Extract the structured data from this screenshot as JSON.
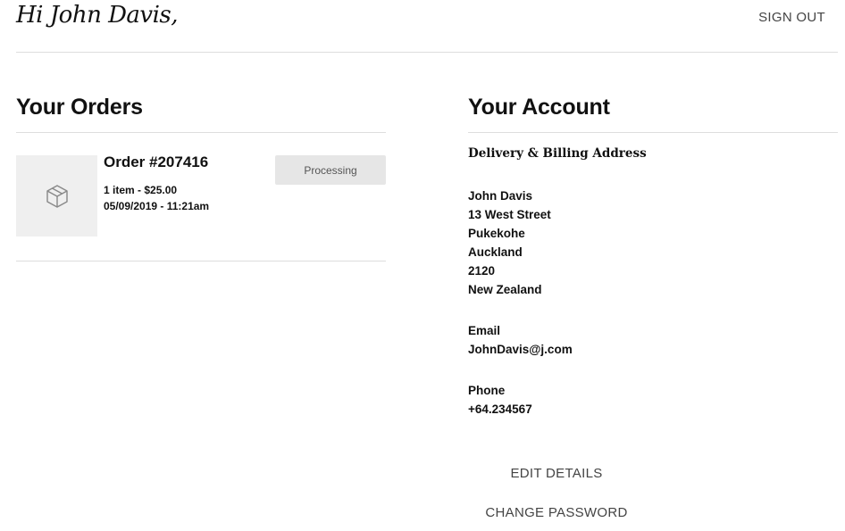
{
  "header": {
    "greeting": "Hi John Davis,",
    "signout_label": "SIGN OUT"
  },
  "orders": {
    "title": "Your Orders",
    "items": [
      {
        "thumbnail_icon": "package-icon",
        "title": "Order #207416",
        "summary": "1 item - $25.00",
        "datetime": "05/09/2019 - 11:21am",
        "status": "Processing"
      }
    ]
  },
  "account": {
    "title": "Your Account",
    "address_heading": "Delivery & Billing Address",
    "address_lines": [
      "John Davis",
      "13 West Street",
      "Pukekohe",
      "Auckland",
      "2120",
      "New Zealand"
    ],
    "email_label": "Email",
    "email": "JohnDavis@j.com",
    "phone_label": "Phone",
    "phone": "+64.234567",
    "edit_label": "EDIT DETAILS",
    "password_label": "CHANGE PASSWORD"
  },
  "colors": {
    "thumb_bg": "#efefef",
    "badge_bg": "#e6e6e6",
    "rule": "#dddddd"
  }
}
